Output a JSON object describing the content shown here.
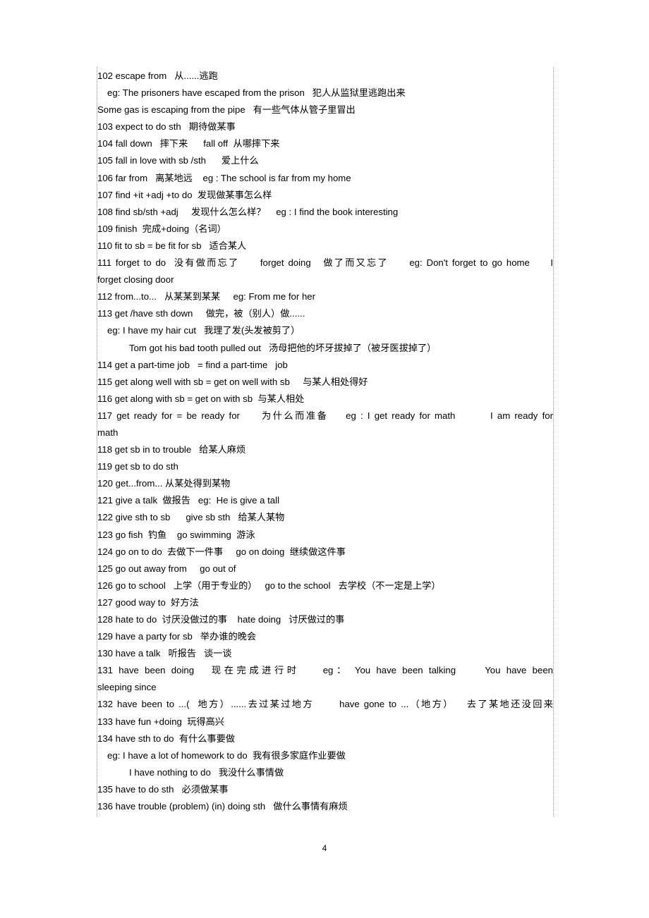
{
  "document": {
    "page_number": "4",
    "entries": [
      {
        "id": "102",
        "text": "102 escape from   从......逃跑",
        "indent": 0,
        "justify": false
      },
      {
        "id": "102-eg1",
        "text": "eg: The prisoners have escaped from the prison   犯人从监狱里逃跑出来",
        "indent": 1,
        "justify": false
      },
      {
        "id": "102-eg2",
        "text": "Some gas is escaping from the pipe   有一些气体从管子里冒出",
        "indent": 0,
        "justify": false
      },
      {
        "id": "103",
        "text": "103 expect to do sth   期待做某事",
        "indent": 0,
        "justify": false
      },
      {
        "id": "104",
        "text": "104 fall down   摔下来      fall off  从哪摔下来",
        "indent": 0,
        "justify": false
      },
      {
        "id": "105",
        "text": "105 fall in love with sb /sth      爱上什么",
        "indent": 0,
        "justify": false
      },
      {
        "id": "106",
        "text": "106 far from   离某地远    eg : The school is far from my home",
        "indent": 0,
        "justify": false
      },
      {
        "id": "107",
        "text": "107 find +it +adj +to do  发现做某事怎么样",
        "indent": 0,
        "justify": false
      },
      {
        "id": "108",
        "text": "108 find sb/sth +adj     发现什么怎么样？    eg : I find the book interesting",
        "indent": 0,
        "justify": false
      },
      {
        "id": "109",
        "text": "109 finish  完成+doing（名词）",
        "indent": 0,
        "justify": false
      },
      {
        "id": "110",
        "text": "110 fit to sb = be fit for sb   适合某人",
        "indent": 0,
        "justify": false
      },
      {
        "id": "111",
        "text": "111 forget to do  没有做而忘了     forget doing   做了而又忘了     eg: Don't forget to go home     I",
        "indent": 0,
        "justify": true
      },
      {
        "id": "111-wrap",
        "text": "forget closing door",
        "indent": 0,
        "justify": false
      },
      {
        "id": "112",
        "text": "112 from...to...   从某某到某某     eg: From me for her",
        "indent": 0,
        "justify": false
      },
      {
        "id": "113",
        "text": "113 get /have sth down     做完，被（别人）做......",
        "indent": 0,
        "justify": false
      },
      {
        "id": "113-eg1",
        "text": "eg: I have my hair cut   我理了发(头发被剪了）",
        "indent": 1,
        "justify": false
      },
      {
        "id": "113-eg2",
        "text": "Tom got his bad tooth pulled out   汤母把他的坏牙拔掉了（被牙医拔掉了）",
        "indent": 2,
        "justify": false
      },
      {
        "id": "114",
        "text": "114 get a part-time job   = find a part-time   job",
        "indent": 0,
        "justify": false
      },
      {
        "id": "115",
        "text": "115 get along well with sb = get on well with sb     与某人相处得好",
        "indent": 0,
        "justify": false
      },
      {
        "id": "116",
        "text": "116 get along with sb = get on with sb  与某人相处",
        "indent": 0,
        "justify": false
      },
      {
        "id": "117",
        "text": "117 get ready for = be ready for     为什么而准备    eg : I get ready for math        I am ready for",
        "indent": 0,
        "justify": true
      },
      {
        "id": "117-wrap",
        "text": "math",
        "indent": 0,
        "justify": false
      },
      {
        "id": "118",
        "text": "118 get sb in to trouble   给某人麻烦",
        "indent": 0,
        "justify": false
      },
      {
        "id": "119",
        "text": "119 get sb to do sth",
        "indent": 0,
        "justify": false
      },
      {
        "id": "120",
        "text": "120 get...from... 从某处得到某物",
        "indent": 0,
        "justify": false
      },
      {
        "id": "121",
        "text": "121 give a talk  做报告   eg:  He is give a tall",
        "indent": 0,
        "justify": false
      },
      {
        "id": "122",
        "text": "122 give sth to sb      give sb sth   给某人某物",
        "indent": 0,
        "justify": false
      },
      {
        "id": "123",
        "text": "123 go fish  钓鱼    go swimming  游泳",
        "indent": 0,
        "justify": false
      },
      {
        "id": "124",
        "text": "124 go on to do  去做下一件事     go on doing  继续做这件事",
        "indent": 0,
        "justify": false
      },
      {
        "id": "125",
        "text": "125 go out away from     go out of",
        "indent": 0,
        "justify": false
      },
      {
        "id": "126",
        "text": "126 go to school   上学（用于专业的）   go to the school   去学校（不一定是上学）",
        "indent": 0,
        "justify": false
      },
      {
        "id": "127",
        "text": "127 good way to  好方法",
        "indent": 0,
        "justify": false
      },
      {
        "id": "128",
        "text": "128 hate to do  讨厌没做过的事    hate doing   讨厌做过的事",
        "indent": 0,
        "justify": false
      },
      {
        "id": "129",
        "text": "129 have a party for sb   举办谁的晚会",
        "indent": 0,
        "justify": false
      },
      {
        "id": "130",
        "text": "130 have a talk   听报告   谈一谈",
        "indent": 0,
        "justify": false
      },
      {
        "id": "131",
        "text": "131 have been doing   现在完成进行时    eg： You have been talking     You have been",
        "indent": 0,
        "justify": true
      },
      {
        "id": "131-wrap",
        "text": "sleeping since",
        "indent": 0,
        "justify": false
      },
      {
        "id": "132",
        "text": "132 have been to ...(  地方）......去过某过地方      have gone to ...（地方）   去了某地还没回来",
        "indent": 0,
        "justify": true
      },
      {
        "id": "133",
        "text": "133 have fun +doing  玩得高兴",
        "indent": 0,
        "justify": false
      },
      {
        "id": "134",
        "text": "134 have sth to do  有什么事要做",
        "indent": 0,
        "justify": false
      },
      {
        "id": "134-eg1",
        "text": "eg: I have a lot of homework to do  我有很多家庭作业要做",
        "indent": 1,
        "justify": false
      },
      {
        "id": "134-eg2",
        "text": "I have nothing to do   我没什么事情做",
        "indent": 2,
        "justify": false
      },
      {
        "id": "135",
        "text": "135 have to do sth   必须做某事",
        "indent": 0,
        "justify": false
      },
      {
        "id": "136",
        "text": "136 have trouble (problem) (in) doing sth   做什么事情有麻烦",
        "indent": 0,
        "justify": false
      }
    ]
  }
}
